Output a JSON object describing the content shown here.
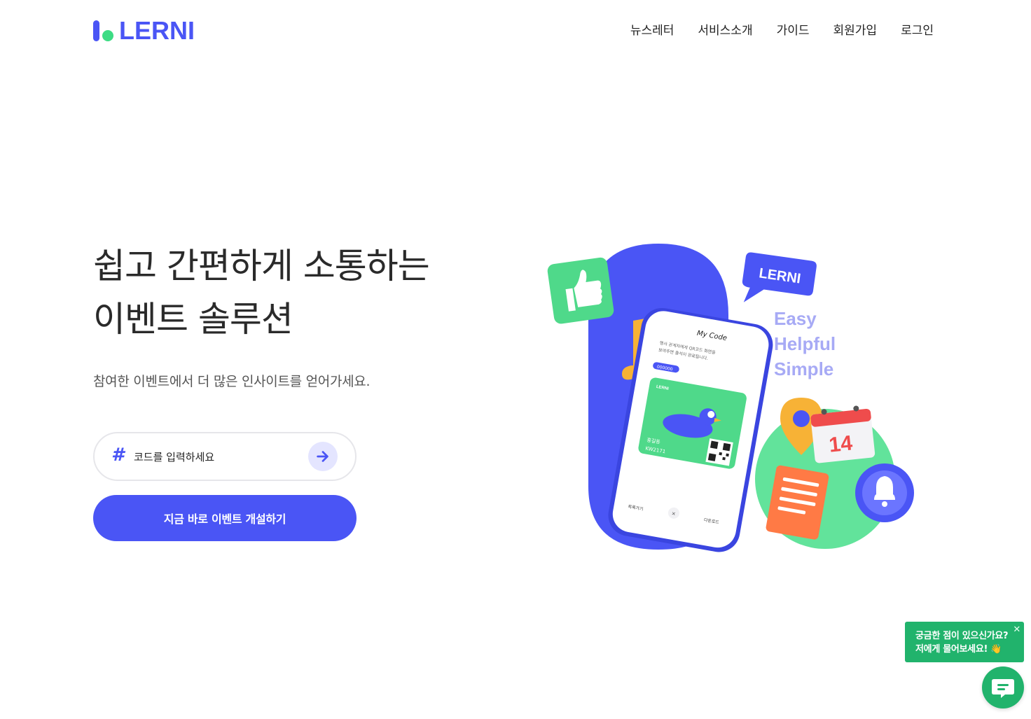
{
  "brand": {
    "name": "LERNI",
    "color": "#4a55f5",
    "accent": "#3ddc84"
  },
  "nav": {
    "items": [
      {
        "label": "뉴스레터"
      },
      {
        "label": "서비스소개"
      },
      {
        "label": "가이드"
      },
      {
        "label": "회원가입"
      },
      {
        "label": "로그인"
      }
    ]
  },
  "hero": {
    "title_line1": "쉽고 간편하게 소통하는",
    "title_line2": "이벤트 솔루션",
    "subtitle": "참여한 이벤트에서 더 많은 인사이트를 얻어가세요.",
    "code_input": {
      "placeholder": "코드를 입력하세요",
      "value": ""
    },
    "cta_label": "지금 바로 이벤트 개설하기"
  },
  "illustration": {
    "badge": "LERNI",
    "taglines": [
      "Easy",
      "Helpful",
      "Simple"
    ],
    "phone": {
      "header": "My Code",
      "note_line1": "행사 관계자에게 QR코드 화면을",
      "note_line2": "보여주면 출석이 완료됩니다.",
      "pill": "000000",
      "card_brand": "LERNI",
      "card_name": "홍길동",
      "card_code": "KW2171",
      "bottom_left": "목록가기",
      "bottom_right": "다운로드"
    },
    "calendar_day": "14"
  },
  "chat": {
    "line1": "궁금한 점이 있으신가요?",
    "line2": "저에게 물어보세요! 👋",
    "close": "✕",
    "color": "#21b36c"
  }
}
